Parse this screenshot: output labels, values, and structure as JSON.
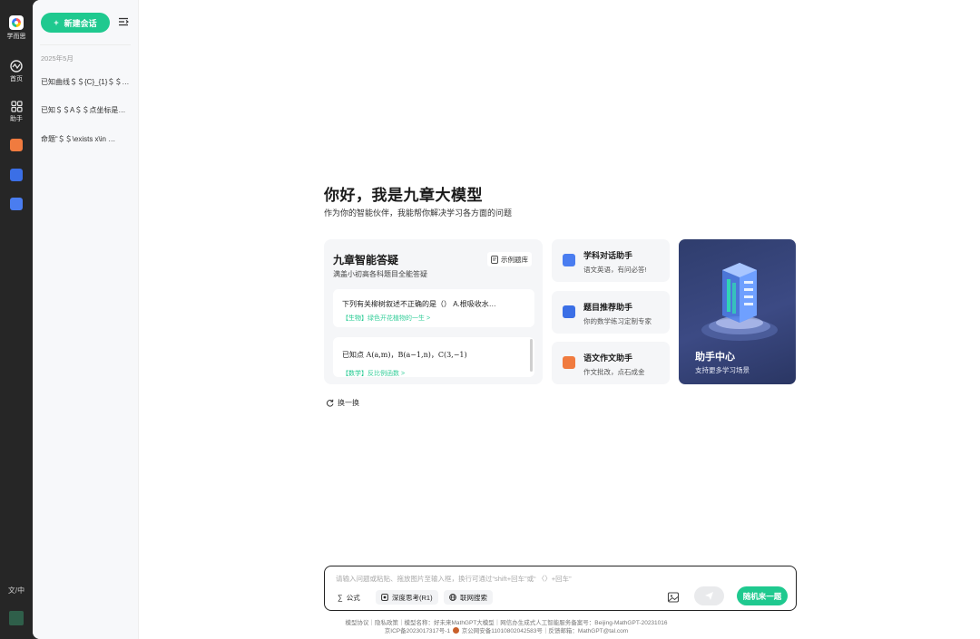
{
  "rail": {
    "logo_label": "学而思",
    "home_label": "首页",
    "assistant_label": "助手",
    "lang_label": "文/中"
  },
  "sidebar": {
    "new_chat_label": "新建会话",
    "date_group": "2025年5月",
    "history": [
      "已知曲线＄＄{C}_{1}＄＄…",
      "已知＄＄A＄＄点坐标是…",
      "命题“＄＄\\exists x\\in …"
    ]
  },
  "main": {
    "title": "你好，我是九章大模型",
    "subtitle": "作为你的智能伙伴，我能帮你解决学习各方面的问题",
    "answer_card": {
      "title": "九章智能答疑",
      "subtitle": "满盖小初高各科题目全能答疑",
      "bank_label": "示例题库",
      "questions": [
        {
          "text": "下列有关柳树叙述不正确的是（） A.根吸收水…",
          "tag": "【生物】",
          "topic": "绿色开花植物的一生 >"
        },
        {
          "text": "已知点 A(a,m)，B(a−1,n)，C(3,−1)",
          "tag": "【数学】",
          "topic": "反比例函数 >"
        }
      ]
    },
    "assistants": [
      {
        "title": "学科对话助手",
        "subtitle": "语文英语，有问必答!",
        "color": "#4a7df0"
      },
      {
        "title": "题目推荐助手",
        "subtitle": "你的数学练习定制专家",
        "color": "#3b6fe6"
      },
      {
        "title": "语文作文助手",
        "subtitle": "作文批改，点石成金",
        "color": "#f07b3f"
      }
    ],
    "center": {
      "title": "助手中心",
      "subtitle": "支持更多学习场景"
    },
    "refresh_label": "换一换"
  },
  "input": {
    "placeholder": "请输入问题或粘贴、拖放图片至输入框，换行可通过“shift+回车”或“ 〈〉+回车”",
    "tools": {
      "formula": "公式",
      "deep_think": "深度思考(R1)",
      "web_search": "联网搜索"
    },
    "random_label": "随机来一题"
  },
  "footer": {
    "line1": "模型协议｜隐私政策｜模型名称：好未来MathGPT大模型｜网信办生成式人工智能服务备案号：Beijing-MathGPT-20231016",
    "line2a": "京ICP备2023017317号-1",
    "line2b": "京公网安备11010802042583号｜反馈邮箱：MathGPT@tal.com"
  },
  "colors": {
    "accent": "#1fc98f",
    "rail_bg": "#262626",
    "center_card_bg": "#354378"
  }
}
